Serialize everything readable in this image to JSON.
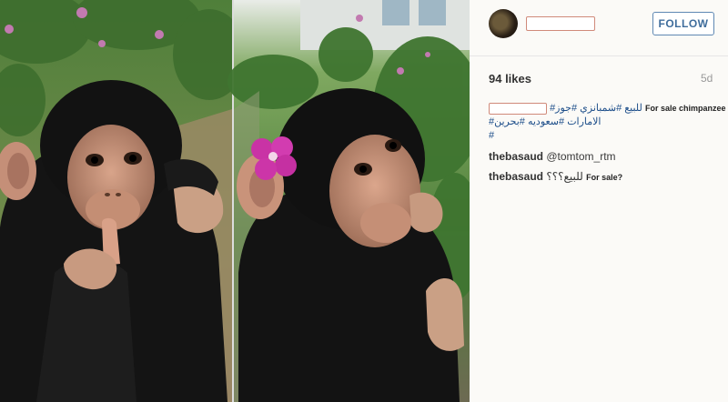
{
  "post": {
    "follow_label": "FOLLOW",
    "likes": "94 likes",
    "age": "5d",
    "caption": {
      "line1_arabic": "للبيع #شمبانزي #جوز#",
      "line1_english": "For sale chimpanzee",
      "line2_arabic": "الامارات #سعوديه #بحرين#",
      "line3": "#"
    },
    "comments": [
      {
        "user": "thebasaud",
        "text": "@tomtom_rtm",
        "extra": ""
      },
      {
        "user": "thebasaud",
        "text": "للبيع؟؟؟",
        "extra": "For sale?"
      }
    ]
  },
  "colors": {
    "follow_blue": "#3f6d9c",
    "hashtag_blue": "#1d4e8a",
    "redaction_border": "#d08a7a"
  }
}
